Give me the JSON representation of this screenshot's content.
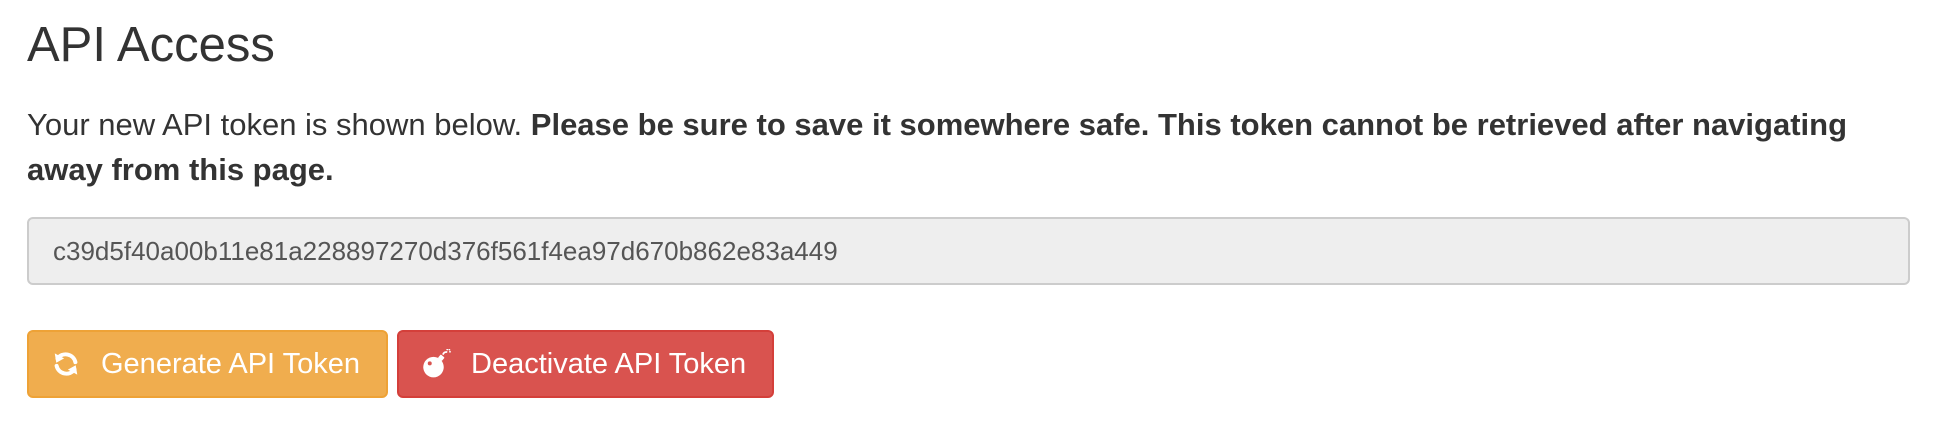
{
  "page": {
    "title": "API Access",
    "notice_intro": "Your new API token is shown below. ",
    "notice_warning": "Please be sure to save it somewhere safe. This token cannot be retrieved after navigating away from this page."
  },
  "token": {
    "value": "c39d5f40a00b11e81a228897270d376f561f4ea97d670b862e83a449"
  },
  "actions": {
    "generate_label": "Generate API Token",
    "generate_icon": "refresh-icon",
    "deactivate_label": "Deactivate API Token",
    "deactivate_icon": "bomb-icon"
  },
  "colors": {
    "warning": "#f0ad4e",
    "danger": "#d9534f",
    "field_bg": "#eeeeee",
    "text": "#333333"
  }
}
